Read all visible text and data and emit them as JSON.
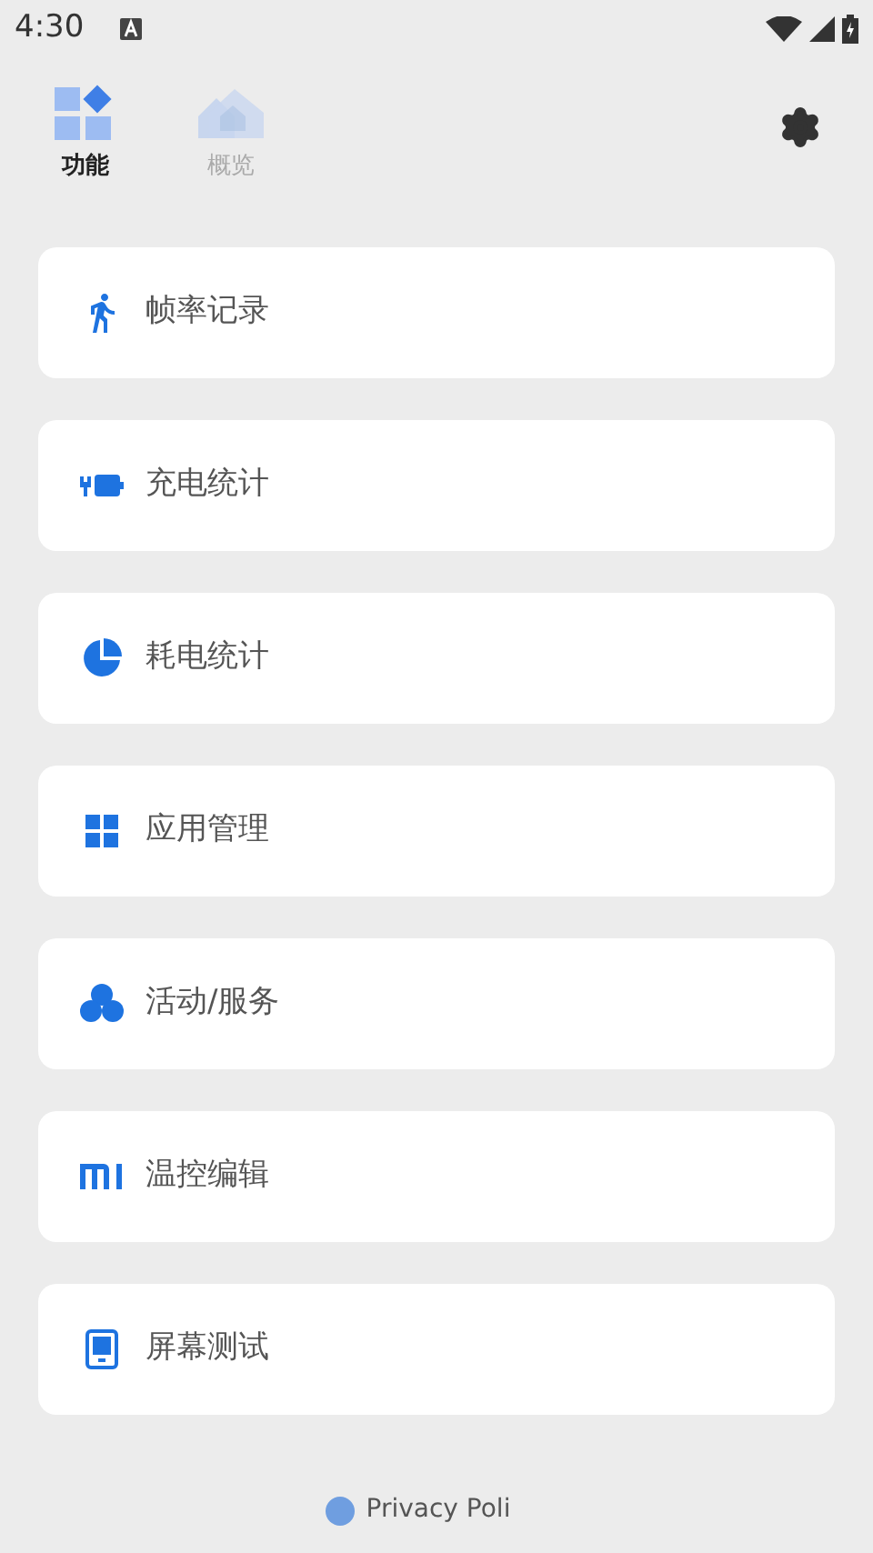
{
  "status_bar": {
    "time": "4:30"
  },
  "tabs": [
    {
      "label": "功能",
      "selected": true,
      "kind": "grid"
    },
    {
      "label": "概览",
      "selected": false,
      "kind": "home"
    }
  ],
  "items": [
    {
      "label": "帧率记录",
      "kind": "run"
    },
    {
      "label": "充电统计",
      "kind": "charge"
    },
    {
      "label": "耗电统计",
      "kind": "pie"
    },
    {
      "label": "应用管理",
      "kind": "apps"
    },
    {
      "label": "活动/服务",
      "kind": "bubbles"
    },
    {
      "label": "温控编辑",
      "kind": "mi"
    },
    {
      "label": "屏幕测试",
      "kind": "tablet"
    }
  ],
  "footer": {
    "link": "Privacy Poli"
  }
}
